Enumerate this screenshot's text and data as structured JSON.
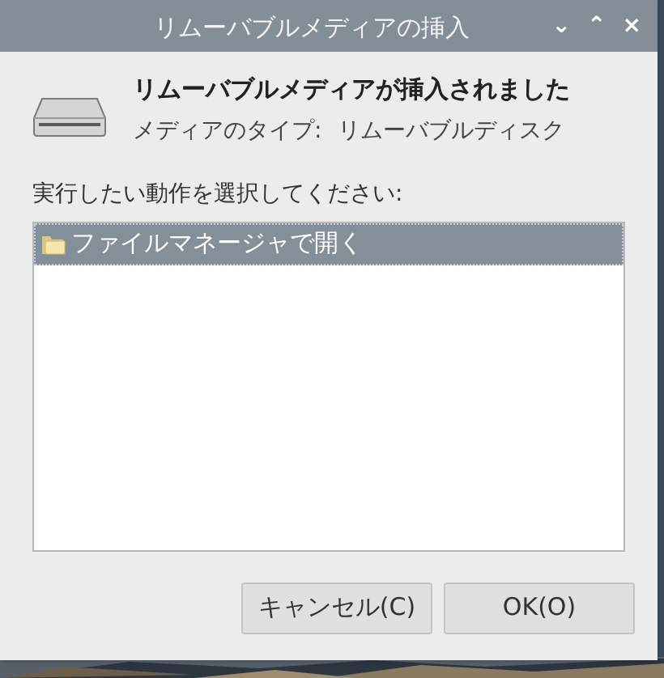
{
  "window": {
    "title": "リムーバブルメディアの挿入",
    "controls": [
      "⌄",
      "⌃",
      "×"
    ]
  },
  "heading": "リムーバブルメディアが挿入されました",
  "media_type": {
    "label": "メディアのタイプ:",
    "value": "リムーバブルディスク"
  },
  "prompt": "実行したい動作を選択してください:",
  "actions": [
    {
      "label": "ファイルマネージャで開く",
      "selected": true
    }
  ],
  "buttons": [
    {
      "label": "キャンセル(C)"
    },
    {
      "label": "OK(O)"
    }
  ]
}
